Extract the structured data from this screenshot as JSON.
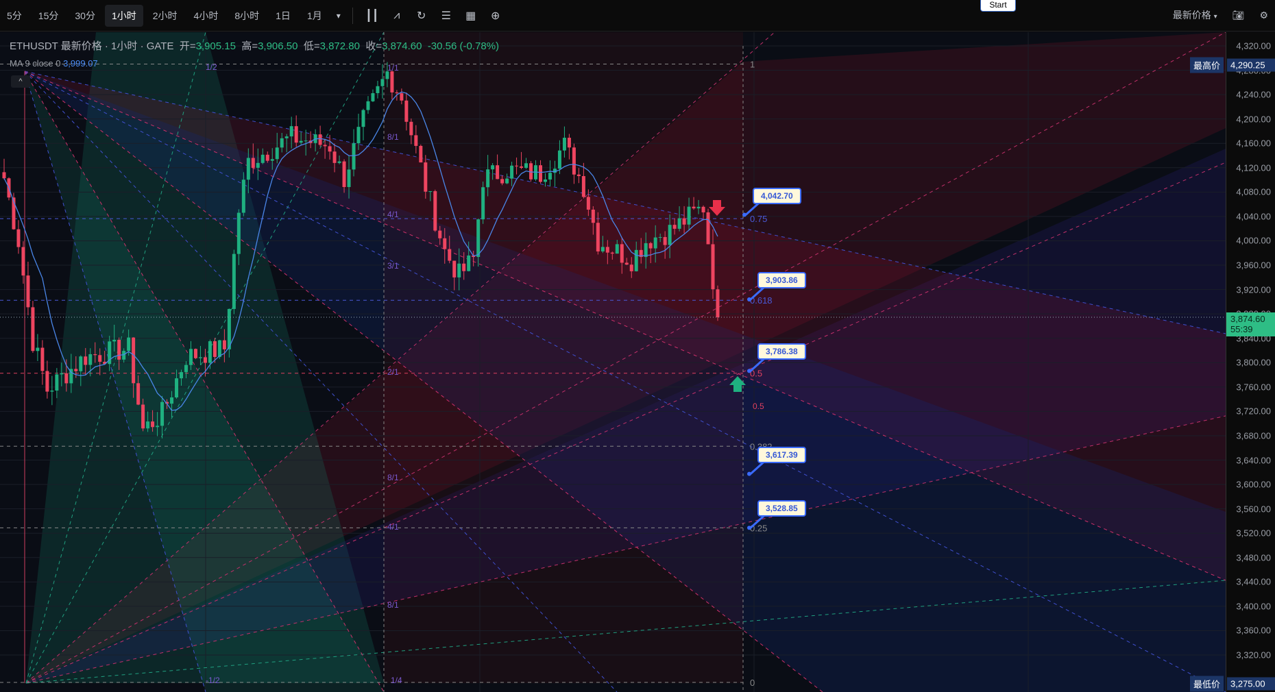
{
  "toolbar": {
    "timeframes": [
      "5分",
      "15分",
      "30分",
      "1小时",
      "2小时",
      "4小时",
      "8小时",
      "1日",
      "1月"
    ],
    "active": "1小时",
    "more_icon": "▾",
    "tools": [
      "candle-type-icon",
      "indicator-icon",
      "replay-icon",
      "template-icon",
      "layout-icon",
      "add-icon"
    ],
    "start_label": "Start",
    "price_type": "最新价格",
    "price_type_caret": "▾"
  },
  "legend": {
    "symbol": "ETHUSDT 最新价格 · 1小时 · GATE",
    "open_label": "开=",
    "open": "3,905.15",
    "high_label": "高=",
    "high": "3,906.50",
    "low_label": "低=",
    "low": "3,872.80",
    "close_label": "收=",
    "close": "3,874.60",
    "change": "-30.56 (-0.78%)"
  },
  "ma": {
    "label": "MA 9 close 0",
    "value": "3,999.07"
  },
  "axis": {
    "ticks": [
      "4,320.00",
      "4,280.00",
      "4,240.00",
      "4,200.00",
      "4,160.00",
      "4,120.00",
      "4,080.00",
      "4,040.00",
      "4,000.00",
      "3,960.00",
      "3,920.00",
      "3,880.00",
      "3,840.00",
      "3,800.00",
      "3,760.00",
      "3,720.00",
      "3,680.00",
      "3,640.00",
      "3,600.00",
      "3,560.00",
      "3,520.00",
      "3,480.00",
      "3,440.00",
      "3,400.00",
      "3,360.00",
      "3,320.00"
    ],
    "high_label": "最高价",
    "high_value": "4,290.25",
    "low_label": "最低价",
    "low_value": "3,275.00",
    "last_price": "3,874.60",
    "countdown": "55:39"
  },
  "fib_levels": [
    {
      "level": "1",
      "price": 4290.25
    },
    {
      "level": "0.75",
      "price": 4036.4
    },
    {
      "level": "0.618",
      "price": 3902.4
    },
    {
      "level": "0.5",
      "price": 3782.6
    },
    {
      "level": "0.382",
      "price": 3662.8
    },
    {
      "level": "0.25",
      "price": 3528.8
    },
    {
      "level": "0",
      "price": 3275
    }
  ],
  "fan_labels": [
    "1/2",
    "1/1",
    "8/1",
    "4/1",
    "3/1",
    "2/1",
    "8/1",
    "4/1",
    "8/1",
    "1/4",
    "-1/2",
    "0.5"
  ],
  "callouts": [
    {
      "value": "4,042.70",
      "price": 4042.7
    },
    {
      "value": "3,903.86",
      "price": 3903.86
    },
    {
      "value": "3,786.38",
      "price": 3786.38
    },
    {
      "value": "3,617.39",
      "price": 3617.39
    },
    {
      "value": "3,528.85",
      "price": 3528.85
    }
  ],
  "price_path": [
    [
      0,
      4103
    ],
    [
      3,
      4000
    ],
    [
      6,
      3836
    ],
    [
      9,
      3756
    ],
    [
      17,
      3810
    ],
    [
      26,
      3823
    ],
    [
      29,
      3690
    ],
    [
      33,
      3716
    ],
    [
      38,
      3810
    ],
    [
      46,
      3823
    ],
    [
      49,
      4050
    ],
    [
      51,
      4130
    ],
    [
      60,
      4170
    ],
    [
      68,
      4156
    ],
    [
      71,
      4103
    ],
    [
      75,
      4196
    ],
    [
      80,
      4276
    ],
    [
      83,
      4236
    ],
    [
      88,
      4090
    ],
    [
      92,
      3983
    ],
    [
      95,
      3943
    ],
    [
      98,
      3970
    ],
    [
      100,
      4103
    ],
    [
      105,
      4116
    ],
    [
      112,
      4110
    ],
    [
      117,
      4156
    ],
    [
      121,
      4090
    ],
    [
      124,
      4000
    ],
    [
      131,
      3970
    ],
    [
      134,
      4000
    ],
    [
      139,
      4016
    ],
    [
      146,
      4056
    ],
    [
      147,
      4000
    ],
    [
      149,
      3874.6
    ]
  ],
  "colors": {
    "up": "#1fb080",
    "down": "#ee4560",
    "ma": "#4a86e8",
    "accent": "#3a6bff"
  }
}
